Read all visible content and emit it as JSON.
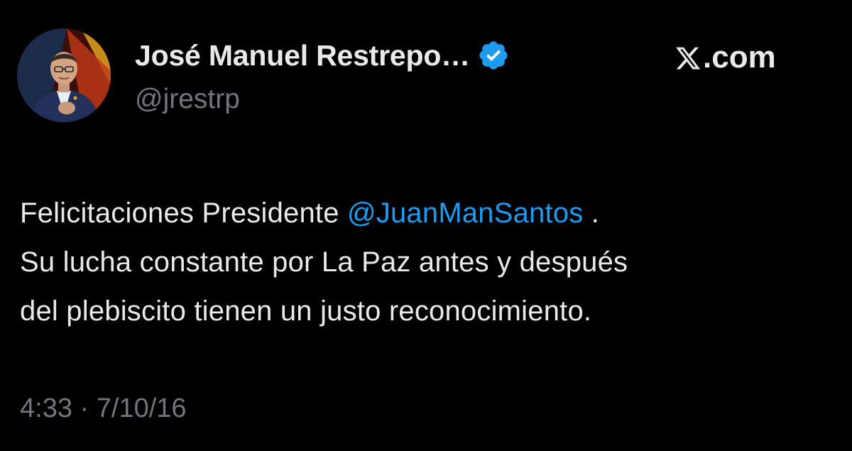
{
  "author": {
    "display_name": "José Manuel Restrepo…",
    "handle": "@jrestrp",
    "verified": true
  },
  "site": {
    "label": ".com",
    "logo_icon": "x-logo-icon"
  },
  "tweet": {
    "line1_prefix": "Felicitaciones Presidente ",
    "mention": "@JuanManSantos",
    "line1_suffix": " .",
    "line2": "Su lucha constante por La Paz antes y después",
    "line3": "del plebiscito tienen un justo reconocimiento."
  },
  "meta": {
    "time": "4:33",
    "separator": " · ",
    "date": "7/10/16"
  },
  "colors": {
    "background": "#000000",
    "text": "#e7e9ea",
    "secondary": "#71767b",
    "accent": "#1d9bf0"
  }
}
